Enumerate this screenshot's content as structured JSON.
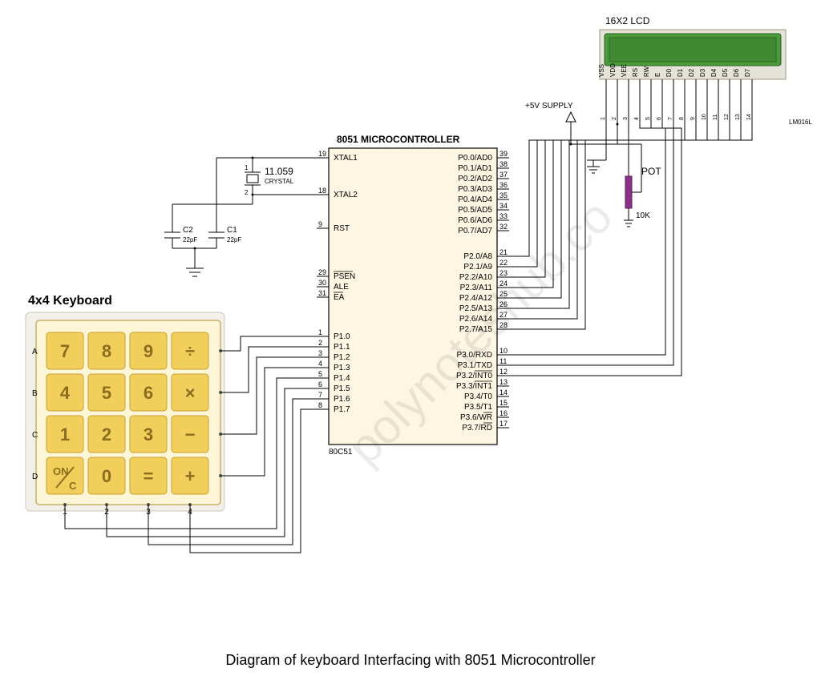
{
  "caption": "Diagram of keyboard Interfacing with 8051 Microcontroller",
  "watermark": "polynoteshub.co",
  "lcd": {
    "title": "16X2 LCD",
    "part": "LM016L",
    "pins": [
      "VSS",
      "VDD",
      "VEE",
      "RS",
      "RW",
      "E",
      "D0",
      "D1",
      "D2",
      "D3",
      "D4",
      "D5",
      "D6",
      "D7"
    ],
    "pinNums": [
      "1",
      "2",
      "3",
      "4",
      "5",
      "6",
      "7",
      "8",
      "9",
      "10",
      "11",
      "12",
      "13",
      "14"
    ]
  },
  "supply": "+5V SUPPLY",
  "pot": {
    "label": "POT",
    "value": "10K"
  },
  "mcu": {
    "title": "8051 MICROCONTROLLER",
    "part": "80C51",
    "left": [
      {
        "pin": "19",
        "name": "XTAL1"
      },
      {
        "pin": "18",
        "name": "XTAL2"
      },
      {
        "pin": "9",
        "name": "RST"
      },
      {
        "pin": "29",
        "name": "PSEN",
        "over": true
      },
      {
        "pin": "30",
        "name": "ALE"
      },
      {
        "pin": "31",
        "name": "EA",
        "over": true
      },
      {
        "pin": "1",
        "name": "P1.0"
      },
      {
        "pin": "2",
        "name": "P1.1"
      },
      {
        "pin": "3",
        "name": "P1.2"
      },
      {
        "pin": "4",
        "name": "P1.3"
      },
      {
        "pin": "5",
        "name": "P1.4"
      },
      {
        "pin": "6",
        "name": "P1.5"
      },
      {
        "pin": "7",
        "name": "P1.6"
      },
      {
        "pin": "8",
        "name": "P1.7"
      }
    ],
    "right": [
      {
        "pin": "39",
        "name": "P0.0/AD0"
      },
      {
        "pin": "38",
        "name": "P0.1/AD1"
      },
      {
        "pin": "37",
        "name": "P0.2/AD2"
      },
      {
        "pin": "36",
        "name": "P0.3/AD3"
      },
      {
        "pin": "35",
        "name": "P0.4/AD4"
      },
      {
        "pin": "34",
        "name": "P0.5/AD5"
      },
      {
        "pin": "33",
        "name": "P0.6/AD6"
      },
      {
        "pin": "32",
        "name": "P0.7/AD7"
      },
      {
        "pin": "21",
        "name": "P2.0/A8"
      },
      {
        "pin": "22",
        "name": "P2.1/A9"
      },
      {
        "pin": "23",
        "name": "P2.2/A10"
      },
      {
        "pin": "24",
        "name": "P2.3/A11"
      },
      {
        "pin": "25",
        "name": "P2.4/A12"
      },
      {
        "pin": "26",
        "name": "P2.5/A13"
      },
      {
        "pin": "27",
        "name": "P2.6/A14"
      },
      {
        "pin": "28",
        "name": "P2.7/A15"
      },
      {
        "pin": "10",
        "name": "P3.0/RXD"
      },
      {
        "pin": "11",
        "name": "P3.1/TXD"
      },
      {
        "pin": "12",
        "name": "P3.2/INT0",
        "over": "INT0"
      },
      {
        "pin": "13",
        "name": "P3.3/INT1",
        "over": "INT1"
      },
      {
        "pin": "14",
        "name": "P3.4/T0"
      },
      {
        "pin": "15",
        "name": "P3.5/T1"
      },
      {
        "pin": "16",
        "name": "P3.6/WR",
        "over": "WR"
      },
      {
        "pin": "17",
        "name": "P3.7/RD",
        "over": "RD"
      }
    ]
  },
  "crystal": {
    "value": "11.059",
    "label": "CRYSTAL"
  },
  "caps": {
    "c1": {
      "name": "C1",
      "value": "22pF"
    },
    "c2": {
      "name": "C2",
      "value": "22pF"
    }
  },
  "keyboard": {
    "title": "4x4 Keyboard",
    "rows": [
      "A",
      "B",
      "C",
      "D"
    ],
    "cols": [
      "1",
      "2",
      "3",
      "4"
    ],
    "keys": [
      [
        "7",
        "8",
        "9",
        "÷"
      ],
      [
        "4",
        "5",
        "6",
        "×"
      ],
      [
        "1",
        "2",
        "3",
        "−"
      ],
      [
        "ON/C",
        "0",
        "=",
        "+"
      ]
    ]
  }
}
